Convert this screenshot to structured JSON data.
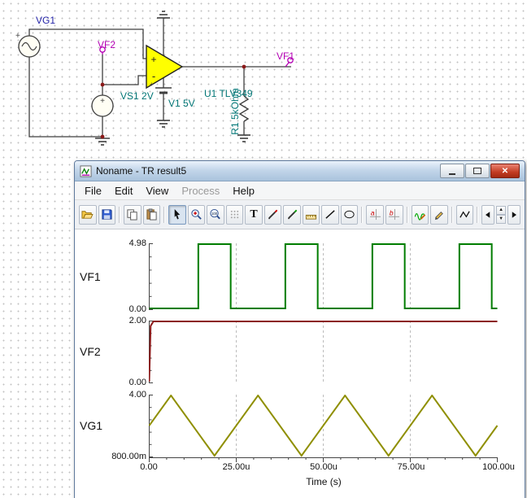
{
  "schematic": {
    "labels": {
      "vg1": "VG1",
      "vf2": "VF2",
      "vf1": "VF1",
      "vs1": "VS1 2V",
      "v1": "V1 5V",
      "u1": "U1 TLV349",
      "r1": "R1 5kOhm"
    },
    "opamp": {
      "plus": "+",
      "minus": "-"
    },
    "plus_sign": "+",
    "colors": {
      "wire": "#3f3f3f",
      "opamp_fill": "#ffff00",
      "probe_label": "#b400b4",
      "component_label": "#007575",
      "generator_label": "#2424a8",
      "junction_dot": "#8b1a1a"
    }
  },
  "window": {
    "title": "Noname - TR result5",
    "controls": [
      "minimize",
      "maximize",
      "close"
    ],
    "menu": {
      "items": [
        "File",
        "Edit",
        "View",
        "Process",
        "Help"
      ],
      "disabled_item": "Process"
    },
    "toolbar": {
      "buttons": [
        "open",
        "save",
        "copy",
        "paste",
        "select-cursor",
        "zoom-in",
        "zoom-100",
        "grid",
        "text-tool",
        "probe-a",
        "probe-b",
        "measure",
        "line-tool",
        "ellipse-tool",
        "cursor-a",
        "cursor-b",
        "trace-edit",
        "pen",
        "polyline",
        "step-left",
        "interval-spinner",
        "step-right"
      ],
      "glyphs": {
        "text_tool": "T",
        "zoom_level": "100",
        "cursor_a": "a",
        "cursor_b": "b"
      }
    }
  },
  "plot_panel": {
    "xaxis": {
      "tick_labels": [
        "0.00",
        "25.00u",
        "50.00u",
        "75.00u",
        "100.00u"
      ],
      "label": "Time (s)",
      "xlim_u": [
        0,
        100
      ],
      "gridlines_u": [
        25,
        50,
        75
      ]
    }
  },
  "chart_data": [
    {
      "type": "line",
      "name": "VF1",
      "color": "#007d00",
      "ylim": [
        0,
        4.98
      ],
      "ymax_label": "4.98",
      "ymin_label": "0.00",
      "x_unit": "us",
      "points": [
        [
          0,
          0
        ],
        [
          14.1,
          0
        ],
        [
          14.1,
          4.98
        ],
        [
          23.4,
          4.98
        ],
        [
          23.4,
          0
        ],
        [
          39.1,
          0
        ],
        [
          39.1,
          4.98
        ],
        [
          48.4,
          4.98
        ],
        [
          48.4,
          0
        ],
        [
          64.1,
          0
        ],
        [
          64.1,
          4.98
        ],
        [
          73.4,
          4.98
        ],
        [
          73.4,
          0
        ],
        [
          89.1,
          0
        ],
        [
          89.1,
          4.98
        ],
        [
          98.4,
          4.98
        ],
        [
          98.4,
          0
        ],
        [
          100,
          0
        ]
      ]
    },
    {
      "type": "line",
      "name": "VF2",
      "color": "#8b1a1a",
      "ylim": [
        0,
        2.0
      ],
      "ymax_label": "2.00",
      "ymin_label": "0.00",
      "x_unit": "us",
      "points": [
        [
          0,
          0
        ],
        [
          0.4,
          1.85
        ],
        [
          1.2,
          2.0
        ],
        [
          100,
          2.0
        ]
      ]
    },
    {
      "type": "line",
      "name": "VG1",
      "color": "#8f8f00",
      "ylim": [
        0.8,
        4.0
      ],
      "ymax_label": "4.00",
      "ymin_label": "800.00m",
      "x_unit": "us",
      "points": [
        [
          0,
          2.4
        ],
        [
          6.25,
          4.0
        ],
        [
          18.75,
          0.8
        ],
        [
          31.25,
          4.0
        ],
        [
          43.75,
          0.8
        ],
        [
          56.25,
          4.0
        ],
        [
          68.75,
          0.8
        ],
        [
          81.25,
          4.0
        ],
        [
          93.75,
          0.8
        ],
        [
          100,
          2.4
        ]
      ]
    }
  ]
}
